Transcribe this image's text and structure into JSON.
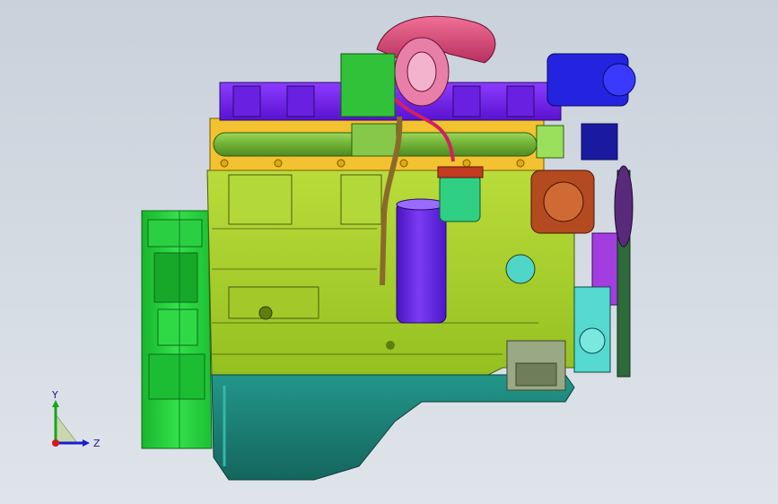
{
  "viewport": {
    "background_top": "#c9d1db",
    "background_bottom": "#dfe4ea"
  },
  "model": {
    "subject": "engine-assembly",
    "parts": [
      {
        "name": "flywheel-housing",
        "color": "#1fd13a"
      },
      {
        "name": "engine-block",
        "color": "#a8cf2d"
      },
      {
        "name": "oil-pan",
        "color": "#1a7a70"
      },
      {
        "name": "intake-manifold",
        "color": "#7ec23f"
      },
      {
        "name": "exhaust-manifold-flange",
        "color": "#f2c230"
      },
      {
        "name": "valve-cover",
        "color": "#7a1ff2"
      },
      {
        "name": "turbocharger",
        "color": "#e0567d"
      },
      {
        "name": "oil-filter",
        "color": "#6b27e6"
      },
      {
        "name": "fuel-filter",
        "color": "#2fcf84"
      },
      {
        "name": "alternator",
        "color": "#2424e0"
      },
      {
        "name": "air-compressor",
        "color": "#b44a1f"
      },
      {
        "name": "belt-pulleys",
        "color": "#a33de0"
      },
      {
        "name": "water-pump",
        "color": "#55d9d0"
      },
      {
        "name": "dipstick-tube",
        "color": "#8a6a2a"
      }
    ]
  },
  "triad": {
    "y_label": "Y",
    "z_label": "Z",
    "x_color": "#d11b1b",
    "y_color": "#1aa51a",
    "z_color": "#1b1bd1"
  }
}
